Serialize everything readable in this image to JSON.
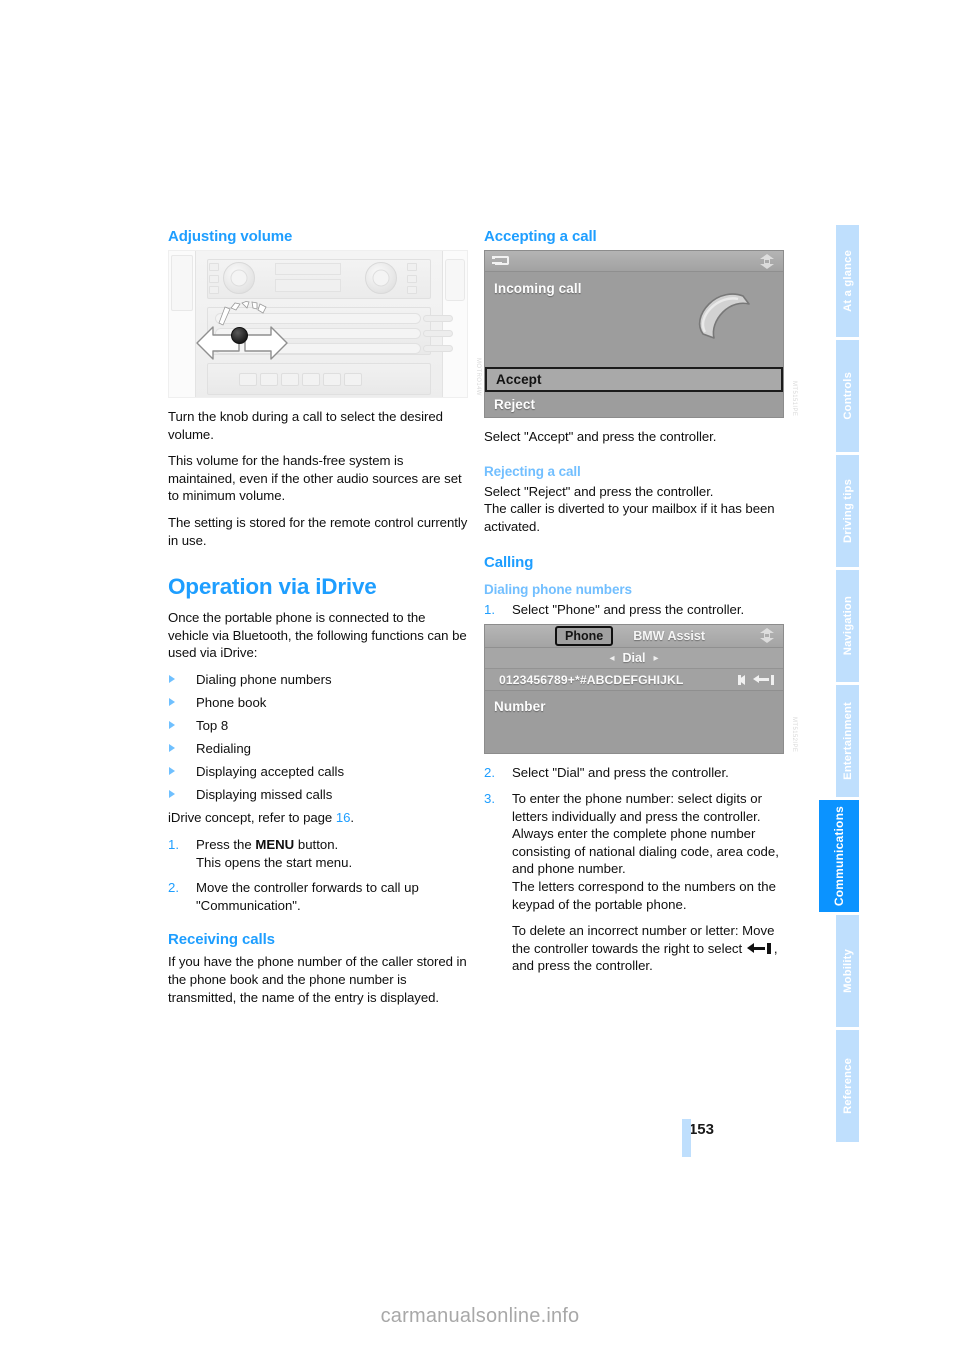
{
  "document": {
    "page_number": "153",
    "watermark": "carmanualsonline.info"
  },
  "left_column": {
    "heading_adjusting_volume": "Adjusting volume",
    "figure_console": {
      "caption_code": "MOTRO14W",
      "alt": "Center console with volume knob and rotation arrows"
    },
    "paragraphs": [
      "Turn the knob during a call to select the desired volume.",
      "This volume for the hands-free system is maintained, even if the other audio sources are set to minimum volume.",
      "The setting is stored for the remote control currently in use."
    ],
    "heading_operation_via_idrive": "Operation via iDrive",
    "intro_idrive": "Once the portable phone is connected to the vehicle via Bluetooth, the following functions can be used via iDrive:",
    "bullets": [
      "Dialing phone numbers",
      "Phone book",
      "Top 8",
      "Redialing",
      "Displaying accepted calls",
      "Displaying missed calls"
    ],
    "idrive_concept_prefix": "iDrive concept, refer to page ",
    "idrive_concept_page": "16",
    "idrive_concept_suffix": ".",
    "steps": [
      {
        "number": "1.",
        "text_before_bold": "Press the ",
        "bold": "MENU",
        "text_after_bold": " button.",
        "sub": "This opens the start menu."
      },
      {
        "number": "2.",
        "text": "Move the controller forwards to call up \"Communication\".",
        "sub": ""
      }
    ],
    "heading_receiving_calls": "Receiving calls",
    "receiving_calls_text": "If you have the phone number of the caller stored in the phone book and the phone number is transmitted, the name of the entry is displayed."
  },
  "right_column": {
    "heading_accepting_a_call": "Accepting a call",
    "figure_incoming_call": {
      "caption_code": "MT5151IPE",
      "title_label": "Incoming call",
      "back_icon": "back-arrow-icon",
      "split_icon": "split-screen-icon",
      "handset_icon": "phone-handset-icon",
      "options": [
        {
          "label": "Accept",
          "selected": true
        },
        {
          "label": "Reject",
          "selected": false
        }
      ]
    },
    "accept_text": "Select \"Accept\" and press the controller.",
    "heading_rejecting_a_call": "Rejecting a call",
    "rejecting_text": "Select \"Reject\" and press the controller.\nThe caller is diverted to your mailbox if it has been activated.",
    "heading_calling": "Calling",
    "heading_dialing_phone_numbers": "Dialing phone numbers",
    "dial_steps": [
      {
        "number": "1.",
        "text": "Select \"Phone\" and press the controller."
      },
      {
        "number": "2.",
        "text": "Select \"Dial\" and press the controller."
      }
    ],
    "figure_dial_screen": {
      "caption_code": "MT5152IPE",
      "tab_phone": "Phone",
      "tab_bmw_assist": "BMW Assist",
      "dial_label": "Dial",
      "dial_arrow_left": "◂",
      "dial_arrow_right": "▸",
      "character_strip": "0123456789+*#ABCDEFGHIJKL",
      "cursor_left_icon": "cursor-left-icon",
      "delete_icon": "backspace-icon",
      "number_label": "Number",
      "split_icon": "split-screen-icon"
    },
    "step3": {
      "number": "3.",
      "text": "To enter the phone number: select digits or letters individually and press the controller. Always enter the complete phone number consisting of national dialing code, area code, and phone number.",
      "sub": "The letters correspond to the numbers on the keypad of the portable phone."
    },
    "delete_note_before": "To delete an incorrect number or letter: Move the controller towards the right to select ",
    "delete_note_after": ", and press the controller."
  },
  "sidebar": {
    "tabs": [
      {
        "label": "At a glance",
        "active": false
      },
      {
        "label": "Controls",
        "active": false
      },
      {
        "label": "Driving tips",
        "active": false
      },
      {
        "label": "Navigation",
        "active": false
      },
      {
        "label": "Entertainment",
        "active": false
      },
      {
        "label": "Communications",
        "active": true
      },
      {
        "label": "Mobility",
        "active": false
      },
      {
        "label": "Reference",
        "active": false
      }
    ]
  },
  "colors": {
    "accent_blue": "#1e9eff",
    "light_blue": "#72bfff",
    "sidebar_inactive": "#bfdffd",
    "sidebar_active": "#0b93ff",
    "body_text": "#0f0f0f"
  }
}
